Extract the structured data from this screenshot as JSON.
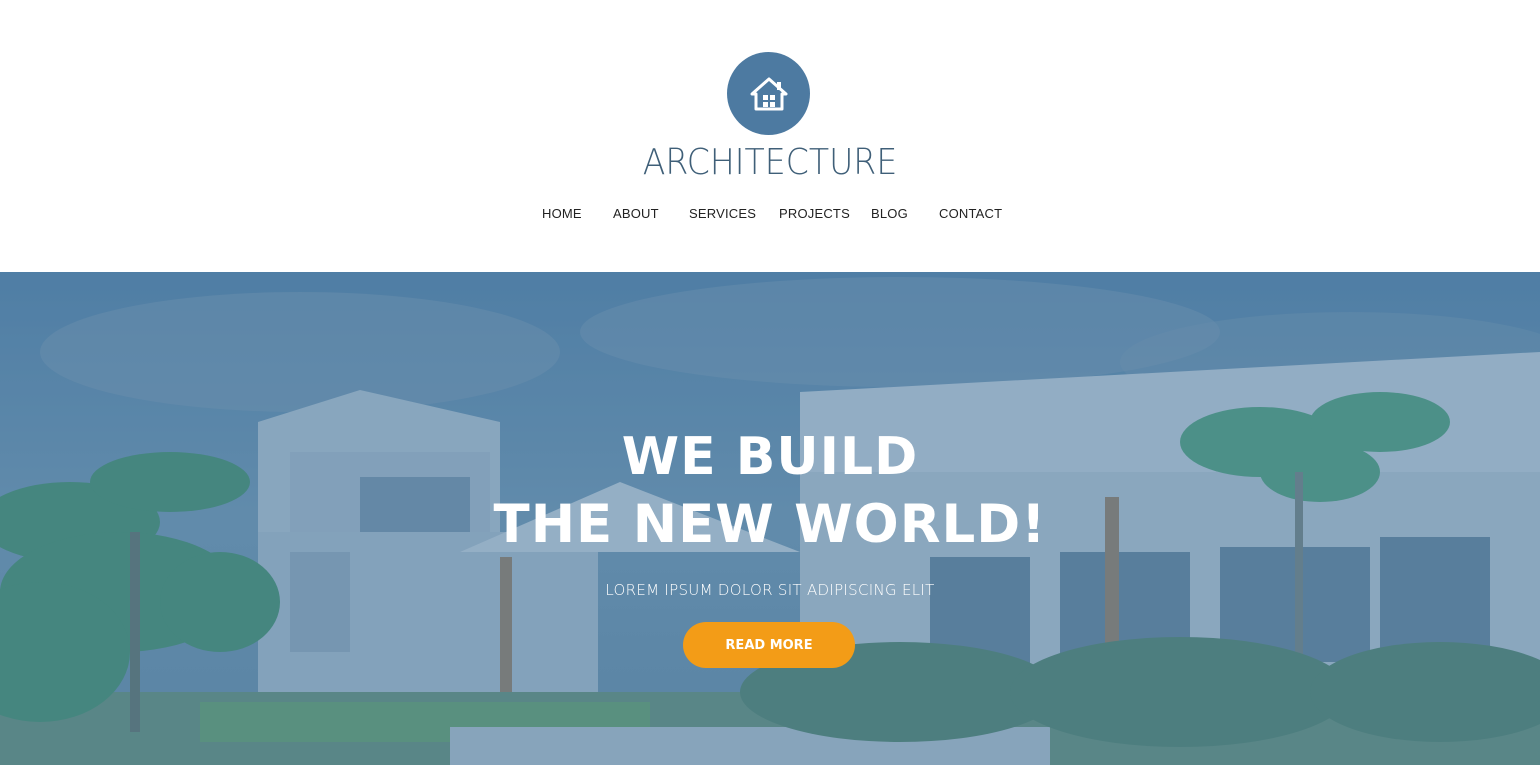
{
  "brand": {
    "name": "ARCHITECTURE",
    "logo_icon": "house-icon",
    "logo_color": "#4d7aa1"
  },
  "nav": {
    "items": [
      {
        "label": "HOME"
      },
      {
        "label": "ABOUT"
      },
      {
        "label": "SERVICES"
      },
      {
        "label": "PROJECTS"
      },
      {
        "label": "BLOG"
      },
      {
        "label": "CONTACT"
      }
    ]
  },
  "hero": {
    "title_line1": "WE BUILD",
    "title_line2": "THE NEW WORLD!",
    "subtitle": "LOREM IPSUM DOLOR SIT ADIPISCING ELIT",
    "cta_label": "READ MORE",
    "overlay_color": "#4f7ea3",
    "cta_color": "#f39c17"
  }
}
